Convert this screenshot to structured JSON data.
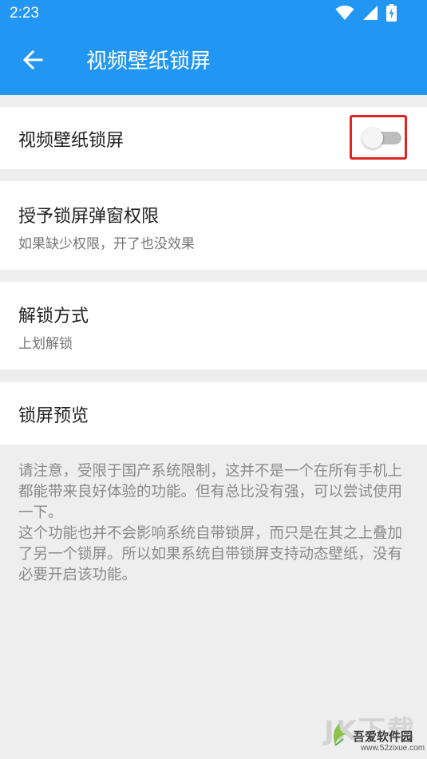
{
  "status_bar": {
    "time": "2:23",
    "icons": [
      "wifi-icon",
      "signal-icon",
      "battery-charging-icon"
    ]
  },
  "app_bar": {
    "back_icon": "arrow-back-icon",
    "title": "视频壁纸锁屏",
    "color": "#2196f3"
  },
  "settings": {
    "video_lock": {
      "title": "视频壁纸锁屏",
      "enabled": false
    },
    "permission": {
      "title": "授予锁屏弹窗权限",
      "subtitle": "如果缺少权限，开了也没效果"
    },
    "unlock_method": {
      "title": "解锁方式",
      "subtitle": "上划解锁"
    },
    "preview": {
      "title": "锁屏预览"
    }
  },
  "note": "请注意，受限于国产系统限制，这并不是一个在所有手机上都能带来良好体验的功能。但有总比没有强，可以尝试使用一下。\n这个功能也并不会影响系统自带锁屏，而只是在其之上叠加了另一个锁屏。所以如果系统自带锁屏支持动态壁纸，没有必要开启该功能。",
  "watermark": {
    "big_text": "JK下载",
    "name": "吾爱软件园",
    "url": "www.52zixue.com"
  },
  "colors": {
    "highlight_border": "#e02424",
    "switch_off_track": "#bdbdbd"
  }
}
